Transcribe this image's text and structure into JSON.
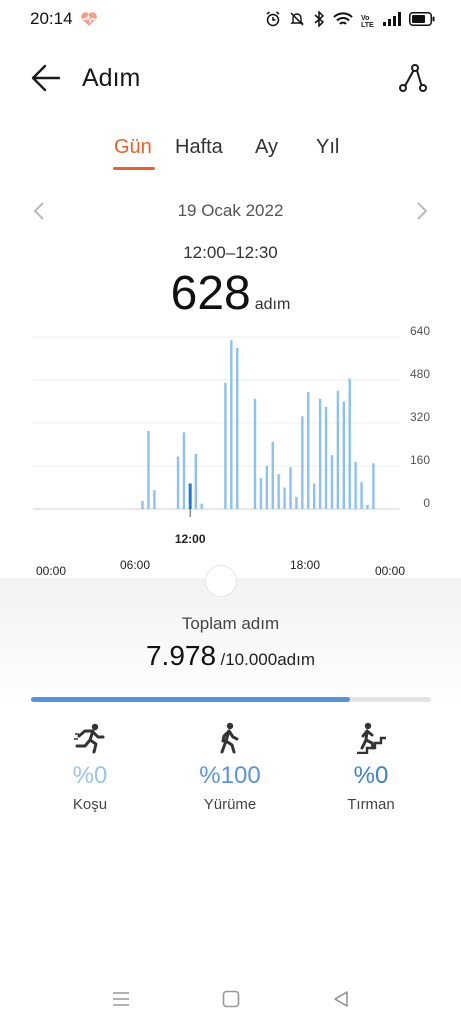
{
  "status_bar": {
    "time": "20:14",
    "icons": [
      "health-app-icon",
      "alarm-icon",
      "mute-icon",
      "bluetooth-icon",
      "wifi-icon",
      "volte-icon",
      "signal-icon",
      "battery-icon"
    ],
    "volte_text": "Vo LTE"
  },
  "header": {
    "title": "Adım",
    "back_icon": "arrow-left-icon",
    "route_icon": "route-icon"
  },
  "tabs": [
    {
      "label": "Gün",
      "active": true
    },
    {
      "label": "Hafta",
      "active": false
    },
    {
      "label": "Ay",
      "active": false
    },
    {
      "label": "Yıl",
      "active": false
    }
  ],
  "date": {
    "label": "19 Ocak 2022"
  },
  "selection": {
    "range": "12:00–12:30",
    "value": "628",
    "unit": "adım"
  },
  "colors": {
    "accent": "#e8602c",
    "bar": "#8ec1ec",
    "bar_selected": "#1f7bd1",
    "progress": "#5b93d9",
    "coral": "#e8602c"
  },
  "chart_data": {
    "type": "bar",
    "y_ticks": [
      "640",
      "480",
      "320",
      "160",
      "0"
    ],
    "ylim": [
      0,
      640
    ],
    "grid": true,
    "x_ticks_lower": [
      "00:00",
      "00:00"
    ],
    "x_ticks_upper": [
      "06:00",
      "18:00"
    ],
    "selected_tick": "12:00",
    "selected_index": 26,
    "bar_slot_minutes": 30,
    "values": [
      0,
      0,
      0,
      0,
      0,
      0,
      0,
      0,
      0,
      0,
      0,
      0,
      0,
      0,
      0,
      0,
      0,
      0,
      30,
      290,
      70,
      0,
      0,
      0,
      195,
      285,
      95,
      205,
      20,
      0,
      0,
      0,
      470,
      628,
      600,
      0,
      0,
      410,
      115,
      160,
      250,
      130,
      80,
      155,
      45,
      345,
      435,
      95,
      410,
      380,
      200,
      440,
      400,
      485,
      175,
      100,
      15,
      170,
      0,
      0,
      0,
      0
    ]
  },
  "summary": {
    "label": "Toplam adım",
    "value": "7.978",
    "goal": "/10.000adım",
    "progress_fraction": 0.7978
  },
  "activities": [
    {
      "icon": "running-icon",
      "percent": "%0",
      "label": "Koşu",
      "color": "#9cc3ea"
    },
    {
      "icon": "walking-icon",
      "percent": "%100",
      "label": "Yürüme",
      "color": "#5b93d9"
    },
    {
      "icon": "climbing-icon",
      "percent": "%0",
      "label": "Tırman",
      "color": "#3f7fcc"
    }
  ],
  "nav_bar": {
    "icons": [
      "menu-icon",
      "home-icon",
      "back-icon"
    ]
  }
}
